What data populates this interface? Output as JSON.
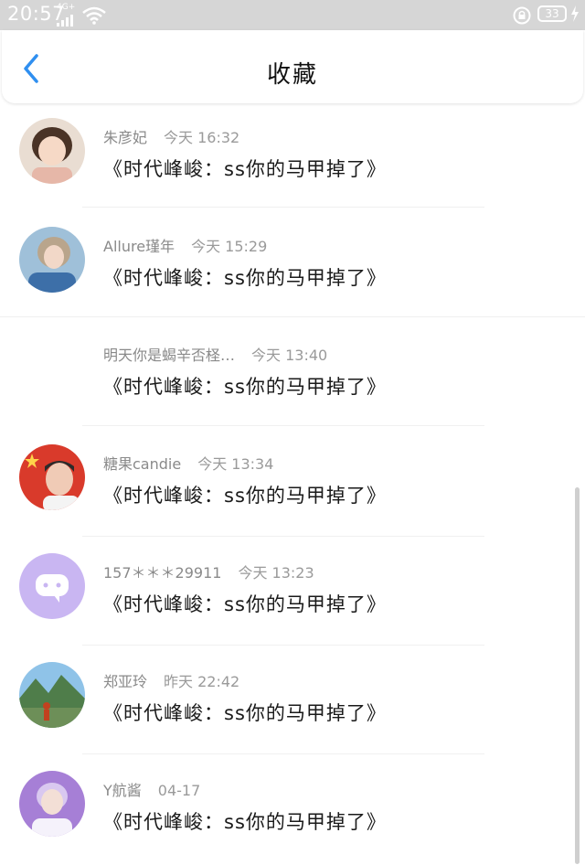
{
  "status_bar": {
    "time": "20:57",
    "network": "4G+",
    "battery": "33"
  },
  "header": {
    "title": "收藏"
  },
  "favorites": [
    {
      "user": "朱彦妃",
      "time": "今天 16:32",
      "title": "《时代峰峻：ss你的马甲掉了》",
      "avatar": "girl-photo"
    },
    {
      "user": "Allure瑾年",
      "time": "今天 15:29",
      "title": "《时代峰峻：ss你的马甲掉了》",
      "avatar": "girl-photo"
    },
    {
      "user": "明天你是蝎辛否柽…",
      "time": "今天 13:40",
      "title": "《时代峰峻：ss你的马甲掉了》",
      "avatar": ""
    },
    {
      "user": "糖果candie",
      "time": "今天 13:34",
      "title": "《时代峰峻：ss你的马甲掉了》",
      "avatar": "flag-photo"
    },
    {
      "user": "157＊＊＊29911",
      "time": "今天 13:23",
      "title": "《时代峰峻：ss你的马甲掉了》",
      "avatar": "chat-bubble-icon"
    },
    {
      "user": "郑亚玲",
      "time": "昨天 22:42",
      "title": "《时代峰峻：ss你的马甲掉了》",
      "avatar": "landscape-photo"
    },
    {
      "user": "Y航酱",
      "time": "04-17",
      "title": "《时代峰峻：ss你的马甲掉了》",
      "avatar": "boy-photo"
    }
  ],
  "colors": {
    "accent": "#2f8ff0",
    "status_bar": "#d6d6d6",
    "default_avatar": "#c9b6f2"
  }
}
